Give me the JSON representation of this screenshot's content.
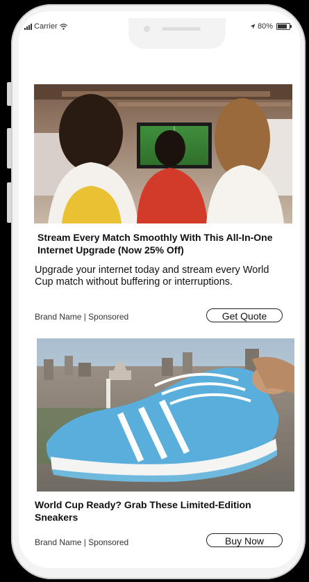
{
  "status_bar": {
    "carrier": "Carrier",
    "battery_percent": "80%"
  },
  "ads": [
    {
      "image_description_icon": "living-room-watching-soccer-image",
      "headline": "Stream Every Match Smoothly With This All-In-One Internet Upgrade (Now 25% Off)",
      "body": "Upgrade your internet today and stream every World Cup match without buffering or interruptions.",
      "brand_line": "Brand Name | Sponsored",
      "cta_label": "Get Quote"
    },
    {
      "image_description_icon": "blue-sneaker-city-image",
      "headline": "World Cup Ready? Grab These Limited-Edition Sneakers",
      "brand_line": "Brand Name | Sponsored",
      "cta_label": "Buy Now"
    }
  ],
  "colors": {
    "phone_frame": "#f3f3f3",
    "background": "#000000",
    "text": "#111111",
    "sneaker_blue": "#5aaedc"
  }
}
